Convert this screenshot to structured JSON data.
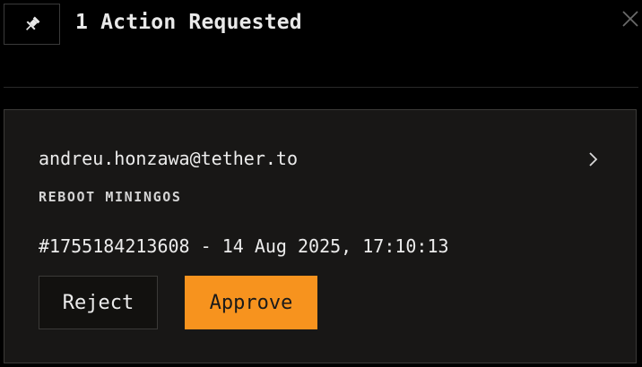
{
  "header": {
    "title": "1 Action Requested",
    "pin_icon": "pin-icon",
    "close_icon": "close-icon"
  },
  "request": {
    "email": "andreu.honzawa@tether.to",
    "action": "REBOOT MININGOS",
    "meta": "#1755184213608 - 14 Aug 2025, 17:10:13",
    "chevron_icon": "chevron-right-icon"
  },
  "buttons": {
    "reject_label": "Reject",
    "approve_label": "Approve"
  },
  "colors": {
    "background": "#000000",
    "card": "#181716",
    "accent": "#f7931e",
    "text": "#ececec"
  }
}
